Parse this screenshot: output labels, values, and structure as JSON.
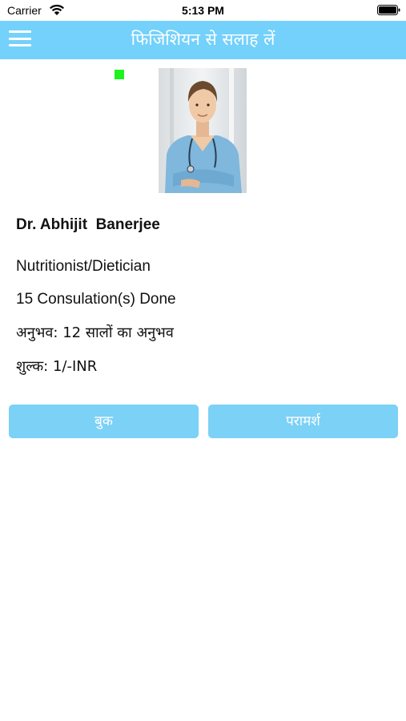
{
  "status_bar": {
    "carrier": "Carrier",
    "time": "5:13 PM"
  },
  "nav": {
    "title": "फिजिशियन से सलाह लें"
  },
  "doctor": {
    "name": "Dr. Abhijit  Banerjee",
    "specialization": "Nutritionist/Dietician",
    "consultations": "15 Consulation(s) Done",
    "experience": "अनुभव: 12 सालों का अनुभव",
    "fee": "शुल्क: 1/-INR"
  },
  "buttons": {
    "book": "बुक",
    "consult": "परामर्श"
  },
  "colors": {
    "nav_bar": "#73d1fb",
    "button": "#7bd1f6",
    "marker": "#1ff21f"
  }
}
